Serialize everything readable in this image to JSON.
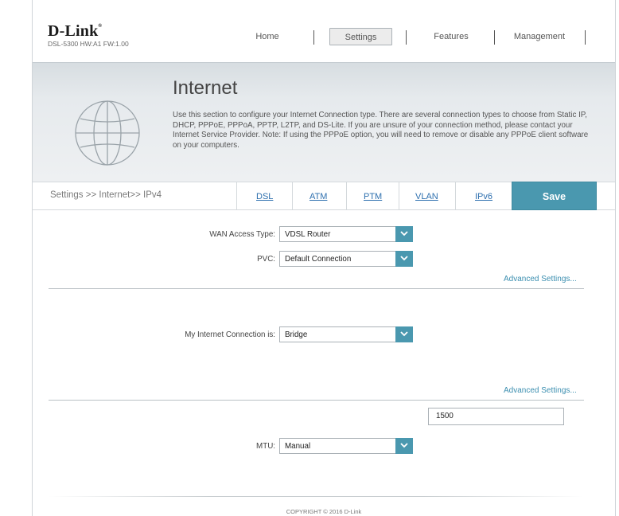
{
  "header": {
    "brand": "D-Link",
    "brand_mark": "®",
    "model": "DSL-5300 HW:A1 FW:1.00"
  },
  "nav": {
    "items": [
      {
        "label": "Home"
      },
      {
        "label": "Settings",
        "active": true
      },
      {
        "label": "Features"
      },
      {
        "label": "Management"
      }
    ]
  },
  "banner": {
    "icon": "globe-icon",
    "title": "Internet",
    "description": "Use this section to configure your Internet Connection type. There are several connection types to choose from Static IP, DHCP, PPPoE, PPPoA, PPTP, L2TP, and DS-Lite. If you are unsure of your connection method, please contact your Internet Service Provider. Note: If using the PPPoE option, you will need to remove or disable any PPPoE client software on your computers."
  },
  "tabbar": {
    "breadcrumb": "Settings >> Internet>> IPv4",
    "tabs": [
      {
        "label": "DSL"
      },
      {
        "label": "ATM"
      },
      {
        "label": "PTM"
      },
      {
        "label": "VLAN"
      },
      {
        "label": "IPv6"
      }
    ],
    "save_label": "Save"
  },
  "form": {
    "wan_access_type": {
      "label": "WAN Access Type:",
      "value": "VDSL Router"
    },
    "pvc": {
      "label": "PVC:",
      "value": "Default Connection"
    },
    "advanced_link_1": "Advanced Settings...",
    "connection": {
      "label": "My Internet Connection is:",
      "value": "Bridge"
    },
    "advanced_link_2": "Advanced Settings...",
    "mtu_value": "1500",
    "mtu": {
      "label": "MTU:",
      "value": "Manual"
    }
  },
  "footer": {
    "copyright": "COPYRIGHT © 2016 D-Link"
  },
  "colors": {
    "accent": "#4a98af",
    "link": "#3c8fb0",
    "tab_link": "#2d6fae"
  }
}
